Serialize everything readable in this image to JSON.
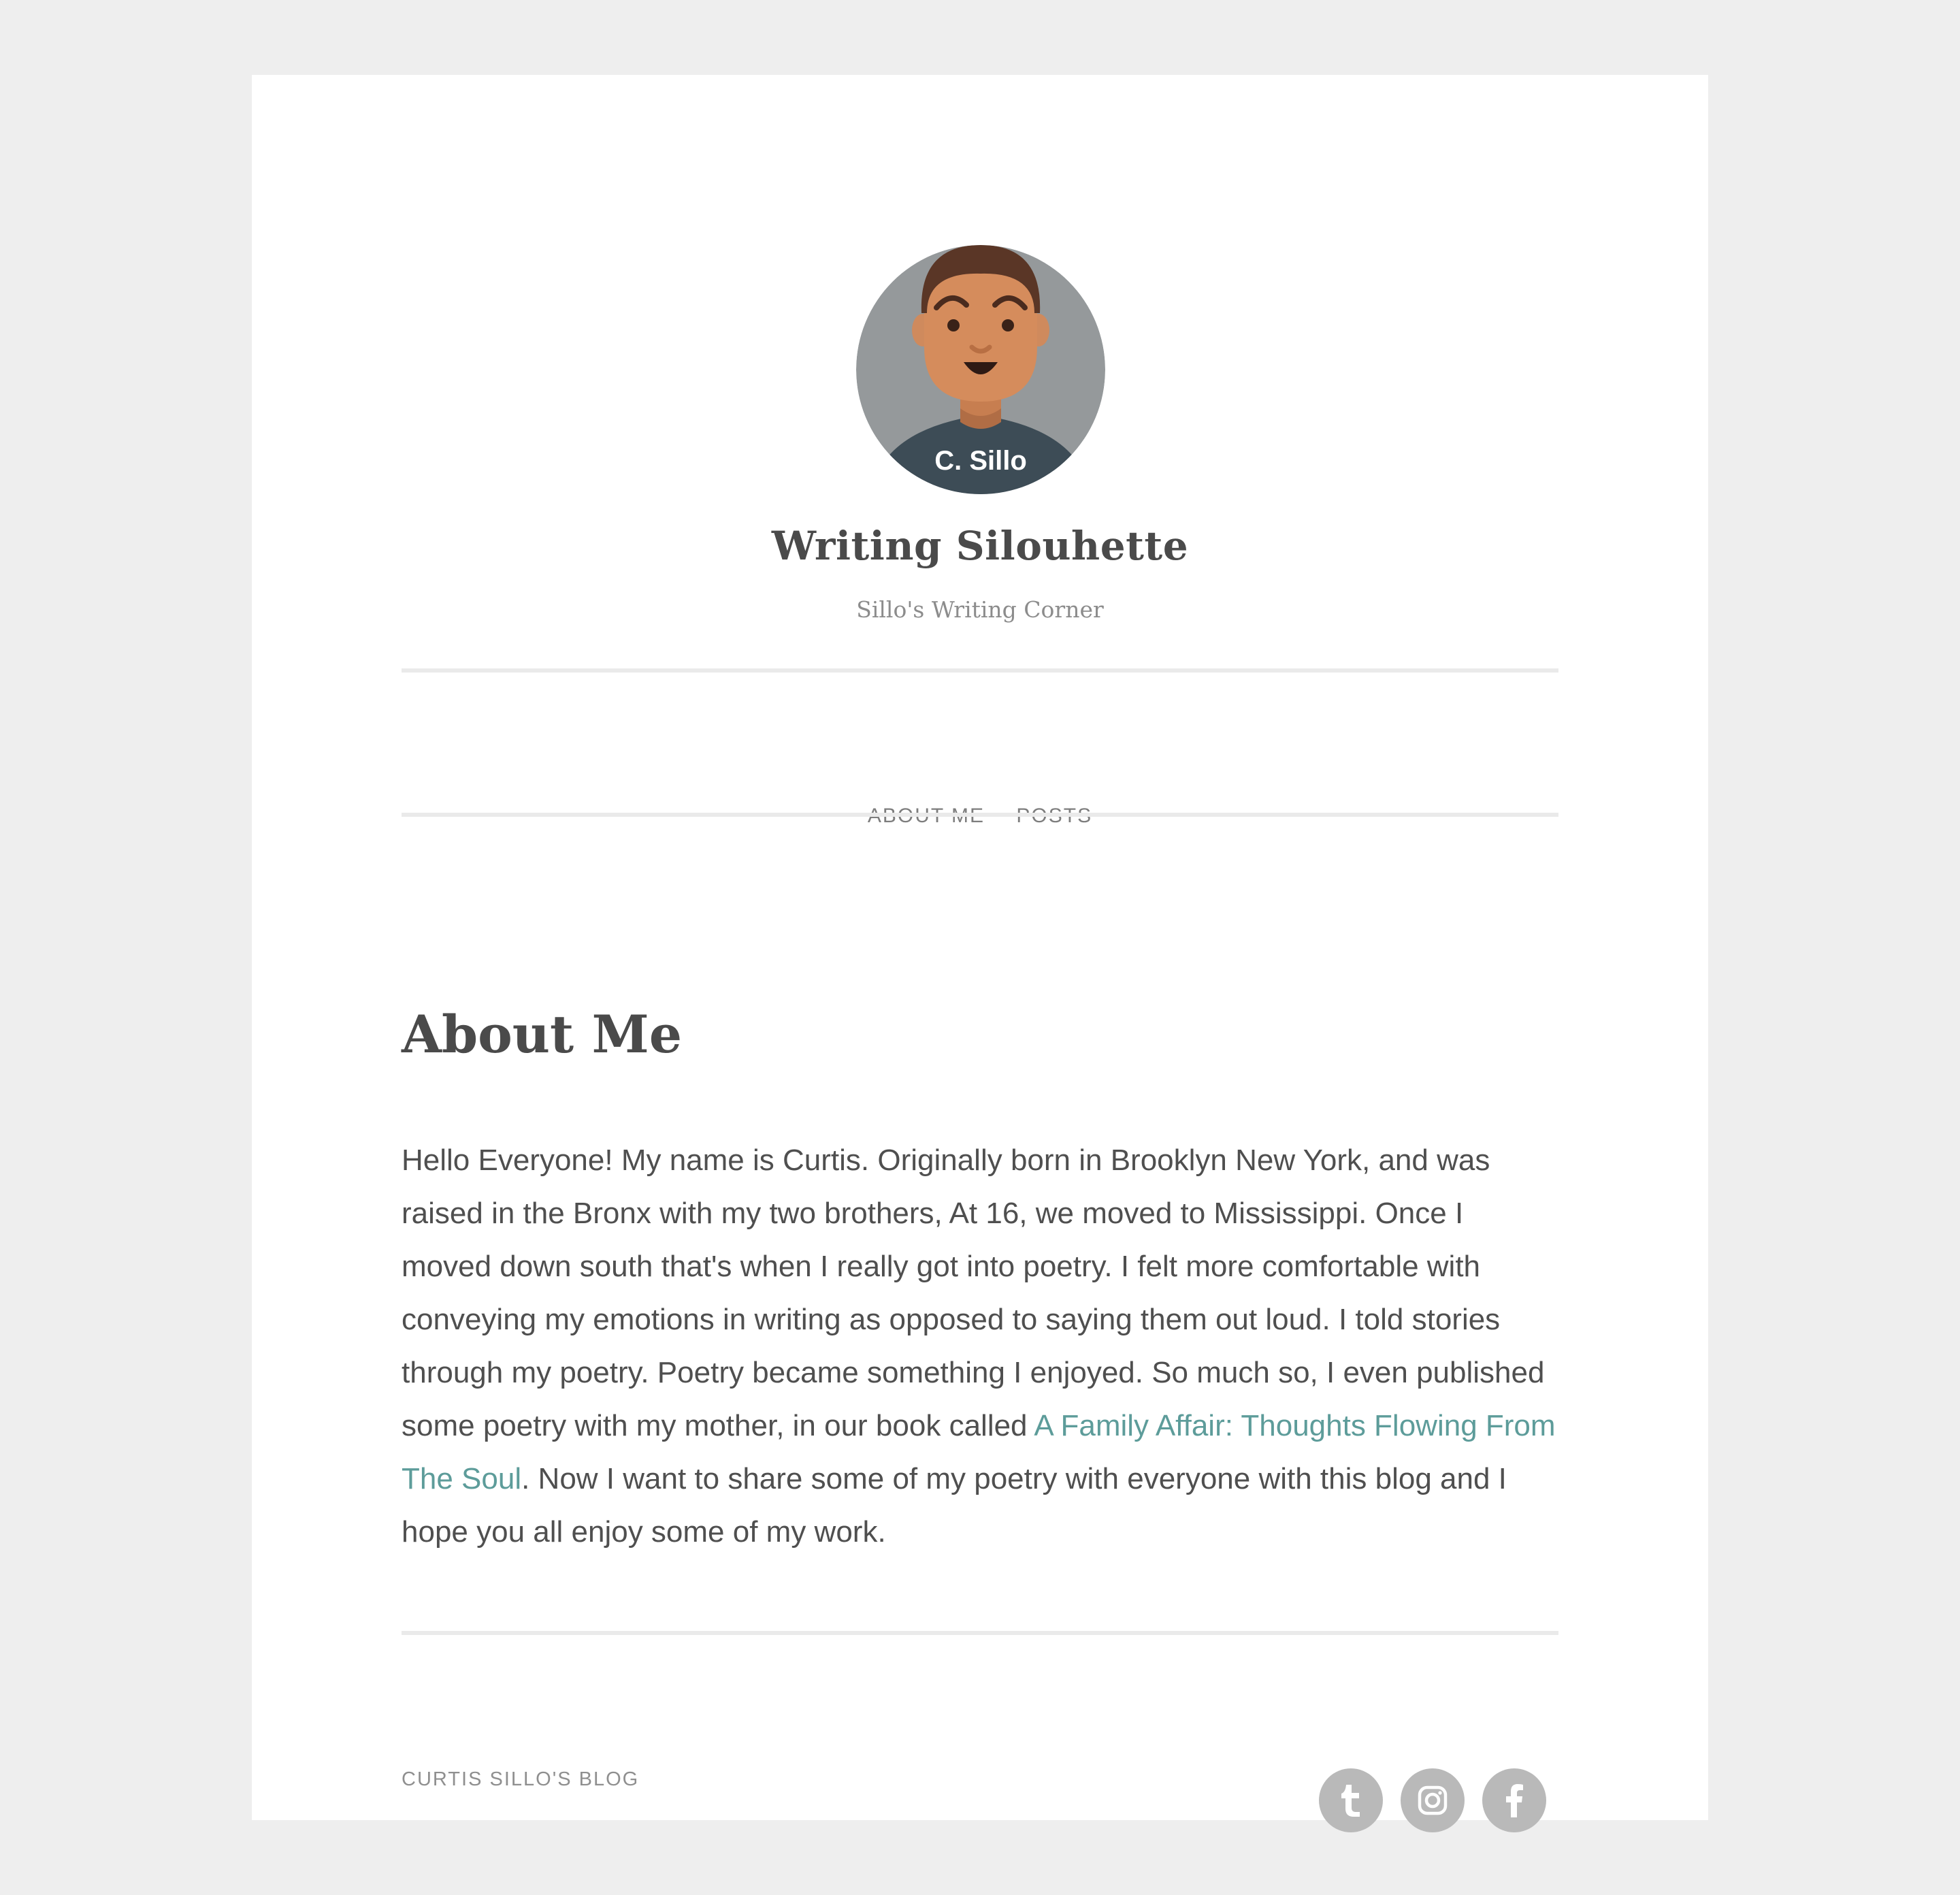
{
  "header": {
    "avatar_caption": "C. Sillo",
    "site_title": "Writing Silouhette",
    "tagline": "Sillo's Writing Corner"
  },
  "nav": {
    "items": [
      {
        "label": "ABOUT ME"
      },
      {
        "label": "POSTS"
      }
    ]
  },
  "article": {
    "title": "About Me",
    "text_before_link": "Hello Everyone! My name is Curtis. Originally born in Brooklyn New York, and was raised in the Bronx with my two brothers, At 16, we moved to Mississippi. Once I moved down south that's when I really got into poetry. I felt more comfortable with conveying my emotions in writing as opposed to saying them out loud. I told stories through my poetry. Poetry became something I enjoyed. So much so, I even published some poetry with my mother, in our book called ",
    "link_text": "A Family Affair: Thoughts Flowing From The Soul",
    "text_after_link": ". Now I want to share some of my poetry with everyone with this blog and I hope you all enjoy some of my work."
  },
  "footer": {
    "site_name": "CURTIS SILLO'S BLOG",
    "social": [
      {
        "icon": "tumblr-icon"
      },
      {
        "icon": "instagram-icon"
      },
      {
        "icon": "facebook-icon"
      }
    ]
  },
  "colors": {
    "page_background": "#eeeeee",
    "card_background": "#ffffff",
    "link": "#5d9c9a",
    "social_circle": "#b9b9b9"
  }
}
